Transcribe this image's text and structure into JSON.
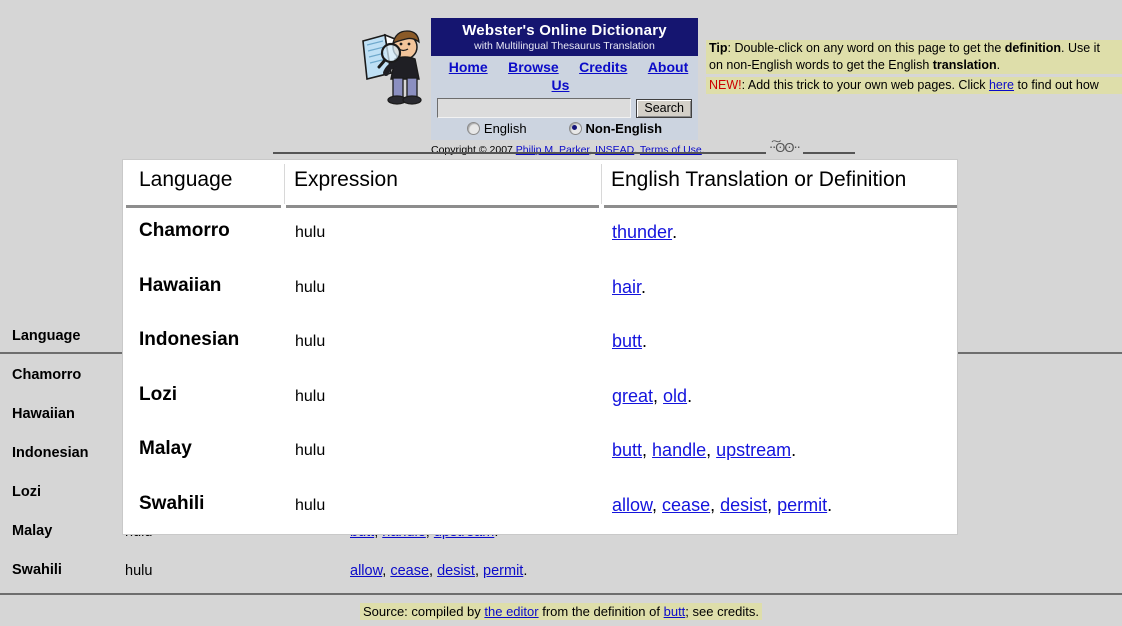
{
  "site": {
    "logo_icon": "man-with-magnifying-glass-reading-book",
    "title": "Webster's Online Dictionary",
    "subtitle": "with Multilingual Thesaurus Translation",
    "nav": [
      {
        "label": "Home"
      },
      {
        "label": "Browse"
      },
      {
        "label": "Credits"
      },
      {
        "label": "About Us"
      }
    ],
    "search": {
      "value": "",
      "placeholder": "",
      "button_label": "Search",
      "scope_options": [
        {
          "label": "English",
          "selected": false
        },
        {
          "label": "Non-English",
          "selected": true
        }
      ]
    },
    "copyright": {
      "prefix": "Copyright © 2007 ",
      "link1": "Philip M. Parker",
      "sep1": ", ",
      "link2": "INSEAD",
      "sep2": ". ",
      "link3": "Terms of Use",
      "suffix": "."
    }
  },
  "tip": {
    "label": "Tip",
    "line1_a": ": Double-click on any word on this page to get the ",
    "line1_bold": "definition",
    "line1_b": ". Use it",
    "line2_a": "on non-English words to get the English ",
    "line2_bold": "translation",
    "line2_b": ".",
    "new_label": "NEW!",
    "line3_a": ": Add this trick to your own web pages. Click ",
    "line3_link": "here",
    "line3_b": " to find out how"
  },
  "ornament": {
    "glyph": "⋅⋅͠ʘʘ⋅⋅"
  },
  "table": {
    "columns": [
      "Language",
      "Expression",
      "English Translation or Definition"
    ],
    "rows": [
      {
        "language": "Chamorro",
        "expression": "hulu",
        "translations": [
          "thunder"
        ]
      },
      {
        "language": "Hawaiian",
        "expression": "hulu",
        "translations": [
          "hair"
        ]
      },
      {
        "language": "Indonesian",
        "expression": "hulu",
        "translations": [
          "butt"
        ]
      },
      {
        "language": "Lozi",
        "expression": "hulu",
        "translations": [
          "great",
          "old"
        ]
      },
      {
        "language": "Malay",
        "expression": "hulu",
        "translations": [
          "butt",
          "handle",
          "upstream"
        ]
      },
      {
        "language": "Swahili",
        "expression": "hulu",
        "translations": [
          "allow",
          "cease",
          "desist",
          "permit"
        ]
      }
    ]
  },
  "footer": {
    "source_prefix": "Source: compiled by ",
    "source_link1": "the editor",
    "source_mid": " from the definition of ",
    "source_link2": "butt",
    "source_suffix": "; see credits."
  },
  "colors": {
    "page_bg": "#d6d6d6",
    "brand_bg": "#151570",
    "nav_bg": "#ccd4e0",
    "link": "#0b0bc8",
    "tip_highlight": "#dedeaa",
    "new_red": "#cc0000",
    "panel_bg": "#ffffff",
    "rule": "#6e6e6e"
  }
}
